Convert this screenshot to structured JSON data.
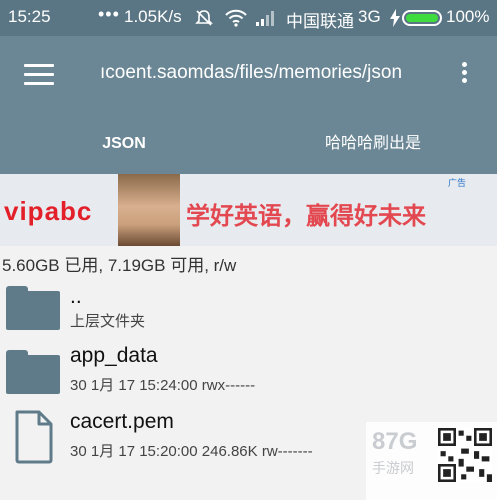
{
  "status_bar": {
    "time": "15:25",
    "speed": "1.05K/s",
    "carrier": "中国联通",
    "network": "3G",
    "battery": "100%",
    "icons": [
      "dots-icon",
      "mute-icon",
      "wifi-icon",
      "signal-icon",
      "charging-icon",
      "battery-icon"
    ]
  },
  "app_bar": {
    "path": "ıcoent.saomdas/files/memories/json",
    "icons": [
      "hamburger-menu-icon",
      "overflow-menu-icon"
    ]
  },
  "tabs": [
    {
      "label": "JSON",
      "active": true
    },
    {
      "label": "哈哈哈刷出是",
      "active": false
    }
  ],
  "ad": {
    "brand": "vipabc",
    "slogan": "学好英语，赢得好未来",
    "tag": "广告"
  },
  "storage_info": "5.60GB 已用, 7.19GB 可用, r/w",
  "files": [
    {
      "name": "..",
      "meta": "上层文件夹",
      "icon": "folder-icon"
    },
    {
      "name": "app_data",
      "meta": "30 1月 17 15:24:00   rwx------",
      "icon": "folder-icon"
    },
    {
      "name": "cacert.pem",
      "meta": "30 1月 17 15:20:00   246.86K   rw-------",
      "icon": "file-icon"
    }
  ],
  "watermark": {
    "logo": "87G",
    "sub": "手游网"
  },
  "colors": {
    "status_bar": "#5a7684",
    "app_bar": "#6b8795",
    "folder": "#5f7b8a",
    "background": "#f2f2f2"
  }
}
